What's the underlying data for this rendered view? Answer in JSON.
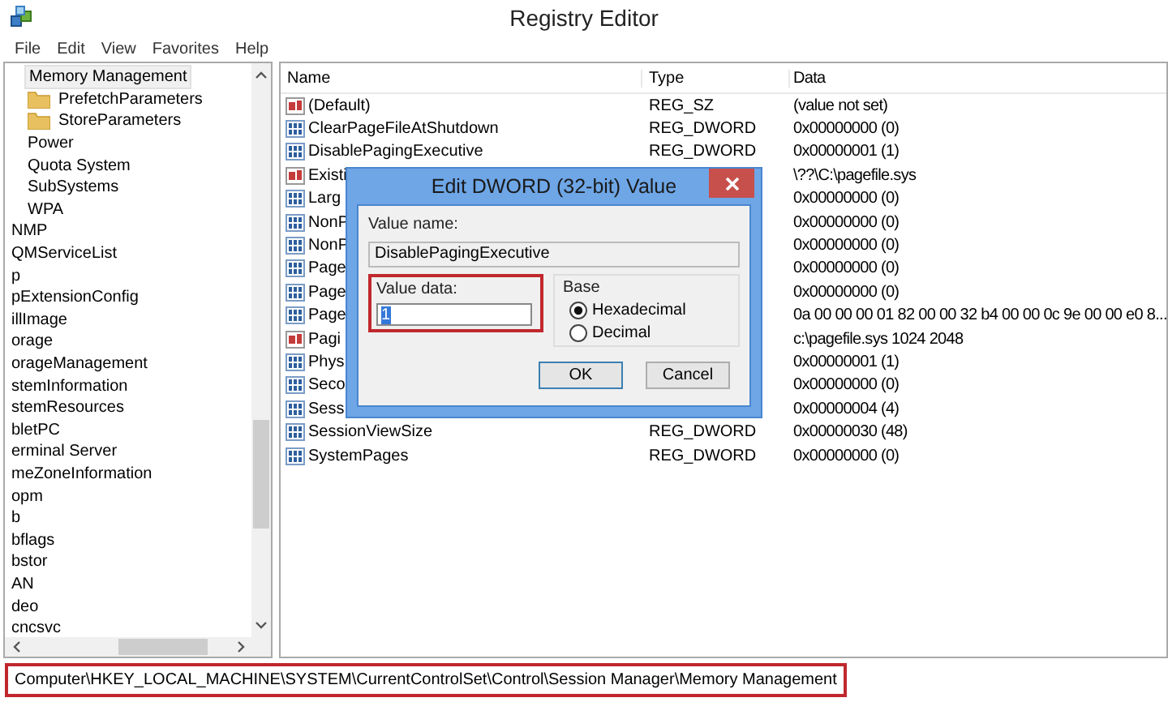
{
  "window": {
    "title": "Registry Editor"
  },
  "menu": [
    "File",
    "Edit",
    "View",
    "Favorites",
    "Help"
  ],
  "tree": {
    "items": [
      {
        "children": [
          {
            "label": "Memory Management",
            "selected": true,
            "children": [
              {
                "label": "PrefetchParameters",
                "selected": false
              },
              {
                "label": "StoreParameters",
                "selected": false
              }
            ]
          },
          {
            "label": "Power",
            "selected": false
          },
          {
            "label": "Quota System",
            "selected": false
          },
          {
            "label": "SubSystems",
            "selected": false
          },
          {
            "label": "WPA",
            "selected": false
          }
        ]
      },
      {
        "label": "NMP",
        "selected": false
      },
      {
        "label": "QMServiceList",
        "selected": false
      },
      {
        "label": "p",
        "selected": false
      },
      {
        "label": "pExtensionConfig",
        "selected": false
      },
      {
        "label": "illImage",
        "selected": false
      },
      {
        "label": "orage",
        "selected": false
      },
      {
        "label": "orageManagement",
        "selected": false
      },
      {
        "label": "stemInformation",
        "selected": false
      },
      {
        "label": "stemResources",
        "selected": false
      },
      {
        "label": "bletPC",
        "selected": false
      },
      {
        "label": "erminal Server",
        "selected": false
      },
      {
        "label": "meZoneInformation",
        "selected": false
      },
      {
        "label": "opm",
        "selected": false
      },
      {
        "label": "b",
        "selected": false
      },
      {
        "label": "bflags",
        "selected": false
      },
      {
        "label": "bstor",
        "selected": false
      },
      {
        "label": "AN",
        "selected": false
      },
      {
        "label": "deo",
        "selected": false
      },
      {
        "label": "cncsvc",
        "selected": false
      }
    ]
  },
  "table": {
    "columns": [
      "Name",
      "Type",
      "Data"
    ],
    "rows": [
      {
        "kind": "string",
        "name": "(Default)",
        "type": "REG_SZ",
        "data": "(value not set)"
      },
      {
        "kind": "dword",
        "name": "ClearPageFileAtShutdown",
        "type": "REG_DWORD",
        "data": "0x00000000 (0)"
      },
      {
        "kind": "dword",
        "name": "DisablePagingExecutive",
        "type": "REG_DWORD",
        "data": "0x00000001 (1)"
      },
      {
        "kind": "string",
        "name": "Existi",
        "data": "\\??\\C:\\pagefile.sys"
      },
      {
        "kind": "dword",
        "name": "Larg",
        "data": "0x00000000 (0)"
      },
      {
        "kind": "dword",
        "name": "NonP",
        "data": "0x00000000 (0)"
      },
      {
        "kind": "dword",
        "name": "NonP",
        "data": "0x00000000 (0)"
      },
      {
        "kind": "dword",
        "name": "Page",
        "data": "0x00000000 (0)"
      },
      {
        "kind": "dword",
        "name": "Page",
        "data": "0x00000000 (0)"
      },
      {
        "kind": "dword",
        "name": "Page",
        "data": "0a 00 00 00 01 82 00 00 32 b4 00 00 0c 9e 00 00 e0 8..."
      },
      {
        "kind": "string",
        "name": "Pagi",
        "data": "c:\\pagefile.sys 1024 2048"
      },
      {
        "kind": "dword",
        "name": "Phys",
        "data": "0x00000001 (1)"
      },
      {
        "kind": "dword",
        "name": "Seco",
        "data": "0x00000000 (0)"
      },
      {
        "kind": "dword",
        "name": "Sess",
        "data": "0x00000004 (4)"
      },
      {
        "kind": "dword",
        "name": "SessionViewSize",
        "type": "REG_DWORD",
        "data": "0x00000030 (48)"
      },
      {
        "kind": "dword",
        "name": "SystemPages",
        "type": "REG_DWORD",
        "data": "0x00000000 (0)"
      }
    ]
  },
  "dialog": {
    "title": "Edit DWORD (32-bit) Value",
    "value_name_label": "Value name:",
    "value_name": "DisablePagingExecutive",
    "value_data_label": "Value data:",
    "value_data": "1",
    "base_label": "Base",
    "base_options": [
      {
        "label": "Hexadecimal",
        "selected": true
      },
      {
        "label": "Decimal",
        "selected": false
      }
    ],
    "buttons": [
      "OK",
      "Cancel"
    ]
  },
  "status_bar": {
    "path": "Computer\\HKEY_LOCAL_MACHINE\\SYSTEM\\CurrentControlSet\\Control\\Session Manager\\Memory Management"
  }
}
